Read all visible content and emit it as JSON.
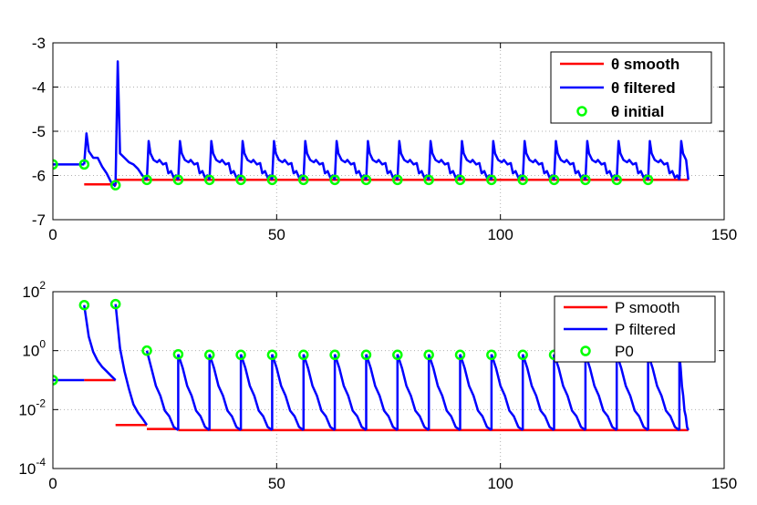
{
  "chart_data": [
    {
      "type": "line",
      "xlim": [
        0,
        150
      ],
      "ylim": [
        -7,
        -3
      ],
      "x_ticks": [
        "0",
        "50",
        "100",
        "150"
      ],
      "y_ticks": [
        "-3",
        "-4",
        "-5",
        "-6",
        "-7"
      ],
      "grid": true,
      "legend_position": "top-right",
      "series": [
        {
          "name": "θ smooth",
          "color": "#ff0000",
          "x": [
            7,
            14,
            14,
            142
          ],
          "y": [
            -6.2,
            -6.2,
            -6.1,
            -6.1
          ]
        },
        {
          "name": "θ filtered",
          "color": "#0000ff",
          "segments": [
            {
              "x": [
                0,
                7
              ],
              "y": [
                -5.75,
                -5.75
              ]
            },
            {
              "x": [
                7,
                7.5,
                8,
                9,
                10,
                11,
                12,
                13,
                14
              ],
              "y": [
                -5.75,
                -5.05,
                -5.45,
                -5.6,
                -5.6,
                -5.8,
                -5.95,
                -6.15,
                -6.25
              ]
            },
            {
              "x": [
                14,
                14.5,
                15,
                16,
                17,
                18,
                19,
                20,
                21
              ],
              "y": [
                -6.2,
                -3.42,
                -5.5,
                -5.6,
                -5.7,
                -5.75,
                -5.85,
                -6.0,
                -6.1
              ]
            }
          ],
          "periodic": {
            "start": 21,
            "period": 7,
            "cycles": 18,
            "end": 142,
            "peak": -5.22,
            "shoulder": -5.65,
            "base": -6.1
          }
        },
        {
          "name": "θ initial",
          "color": "#00ff00",
          "marker": "circle",
          "x": [
            0,
            7,
            14,
            21,
            28,
            35,
            42,
            49,
            56,
            63,
            70,
            77,
            84,
            91,
            98,
            105,
            112,
            119,
            126,
            133
          ],
          "y": [
            -5.75,
            -5.75,
            -6.22,
            -6.1,
            -6.1,
            -6.1,
            -6.1,
            -6.1,
            -6.1,
            -6.1,
            -6.1,
            -6.1,
            -6.1,
            -6.1,
            -6.1,
            -6.1,
            -6.1,
            -6.1,
            -6.1,
            -6.1
          ]
        }
      ]
    },
    {
      "type": "line",
      "xlim": [
        0,
        150
      ],
      "yscale": "log",
      "ylim": [
        0.0001,
        100
      ],
      "x_ticks": [
        "0",
        "50",
        "100",
        "150"
      ],
      "y_ticks": [
        {
          "base": "10",
          "exp": "2",
          "value": 100
        },
        {
          "base": "10",
          "exp": "0",
          "value": 1
        },
        {
          "base": "10",
          "exp": "-2",
          "value": 0.01
        },
        {
          "base": "10",
          "exp": "-4",
          "value": 0.0001
        }
      ],
      "grid": true,
      "legend_position": "top-right",
      "series": [
        {
          "name": "P smooth",
          "color": "#ff0000",
          "segments": [
            {
              "x": [
                7,
                14
              ],
              "y": [
                0.1,
                0.1
              ]
            },
            {
              "x": [
                14,
                21
              ],
              "y": [
                0.003,
                0.003
              ]
            },
            {
              "x": [
                21,
                28
              ],
              "y": [
                0.0022,
                0.0022
              ]
            },
            {
              "x": [
                28,
                142
              ],
              "y": [
                0.002,
                0.002
              ]
            }
          ]
        },
        {
          "name": "P filtered",
          "color": "#0000ff",
          "segments": [
            {
              "x": [
                0,
                7
              ],
              "y": [
                0.1,
                0.1
              ]
            },
            {
              "x": [
                7,
                8,
                9,
                10,
                11,
                12,
                13,
                14
              ],
              "y": [
                35,
                3,
                0.9,
                0.45,
                0.28,
                0.2,
                0.14,
                0.1
              ]
            },
            {
              "x": [
                14,
                15,
                16,
                17,
                18,
                19,
                20,
                21
              ],
              "y": [
                38,
                1.2,
                0.2,
                0.05,
                0.015,
                0.008,
                0.005,
                0.003
              ]
            }
          ],
          "periodic": {
            "start": 21,
            "period": 7,
            "cycles": 18,
            "end": 142,
            "decay_y": [
              0.75,
              0.22,
              0.07,
              0.025,
              0.01,
              0.005,
              0.0028,
              0.002
            ],
            "first_peak": 1.0
          }
        },
        {
          "name": "P0",
          "color": "#00ff00",
          "marker": "circle",
          "x": [
            0,
            7,
            14,
            21,
            28,
            35,
            42,
            49,
            56,
            63,
            70,
            77,
            84,
            91,
            98,
            105,
            112
          ],
          "y": [
            0.1,
            35,
            38,
            1.0,
            0.75,
            0.72,
            0.72,
            0.72,
            0.72,
            0.72,
            0.72,
            0.72,
            0.72,
            0.72,
            0.72,
            0.72,
            0.72
          ]
        }
      ]
    }
  ]
}
